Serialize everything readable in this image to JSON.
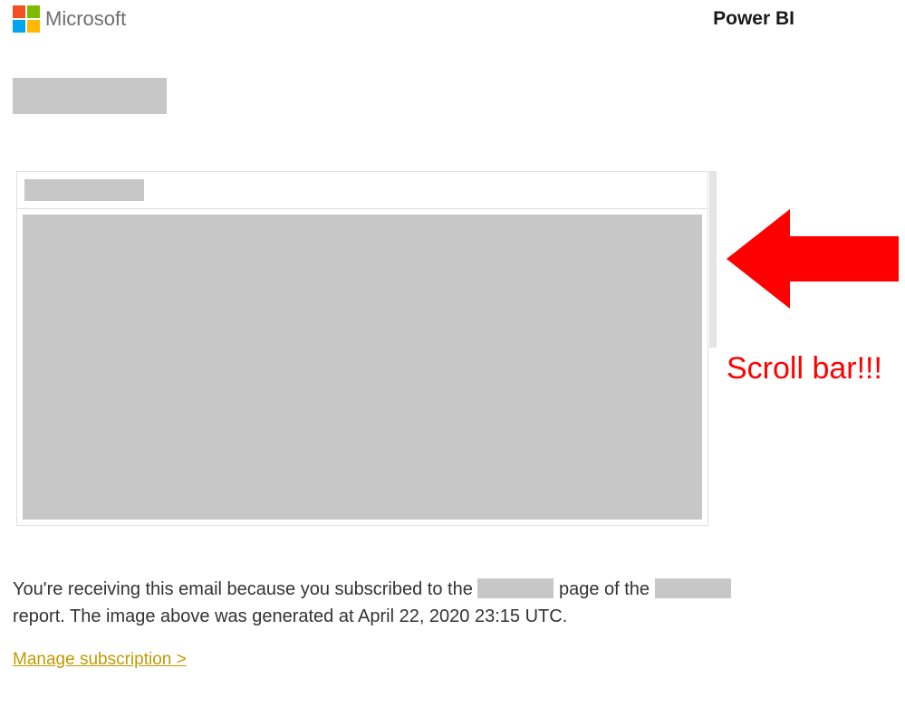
{
  "header": {
    "brand": "Microsoft",
    "product": "Power BI"
  },
  "annotation": {
    "label": "Scroll bar!!!",
    "color": "#ff0000"
  },
  "footer": {
    "prefix": "You're receiving this email because you subscribed to the ",
    "mid1": " page of the ",
    "mid2": " report. The image above was generated at ",
    "timestamp": "April 22, 2020 23:15 UTC",
    "suffix": "."
  },
  "link": {
    "manage_label": "Manage subscription >"
  }
}
